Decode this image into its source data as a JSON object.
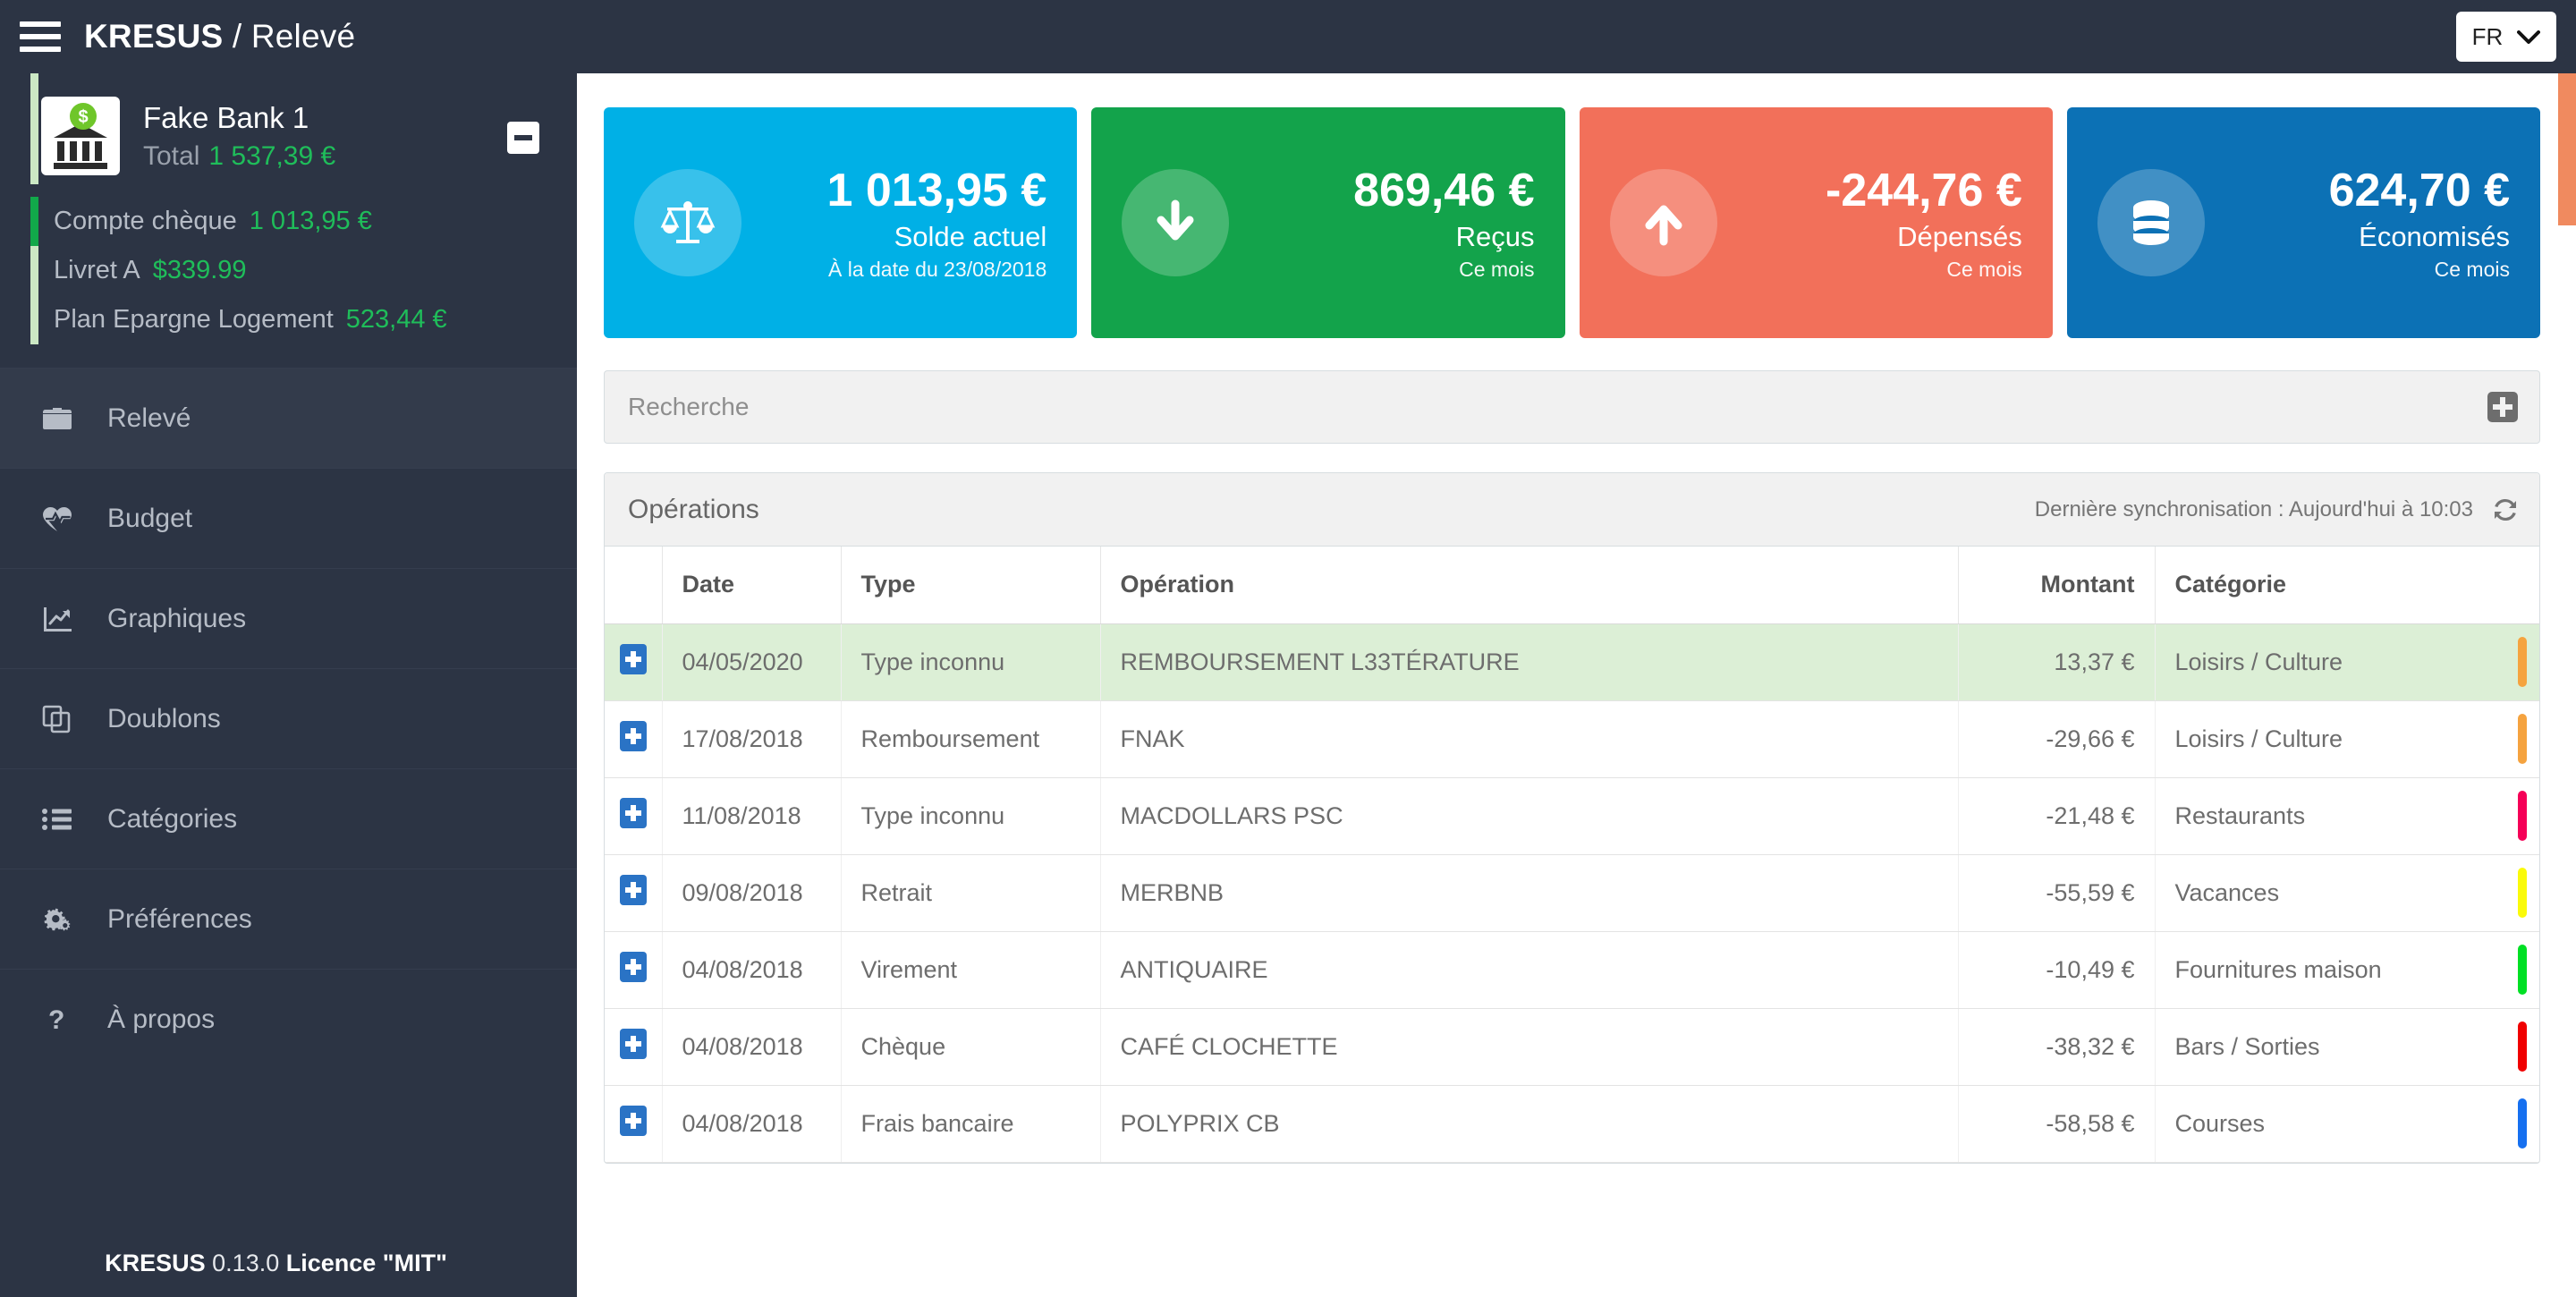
{
  "topbar": {
    "menu_icon": "hamburger-icon",
    "brand": "KRESUS",
    "separator": " / ",
    "page": "Relevé",
    "language": "FR",
    "language_chevron": "chevron-down-icon"
  },
  "sidebar": {
    "bank": {
      "name": "Fake Bank 1",
      "total_label": "Total",
      "total_value": "1 537,39 €",
      "logo_icon": "bank-icon",
      "collapse_icon": "minus-icon"
    },
    "accounts": [
      {
        "label": "Compte chèque",
        "value": "1 013,95 €",
        "active": true,
        "stripe_color": "#11a84a"
      },
      {
        "label": "Livret A",
        "value": "$339.99",
        "active": false,
        "stripe_color": "#cbe8c4"
      },
      {
        "label": "Plan Epargne Logement",
        "value": "523,44 €",
        "active": false,
        "stripe_color": "#cbe8c4"
      }
    ],
    "nav": [
      {
        "label": "Relevé",
        "icon": "briefcase-icon",
        "active": true
      },
      {
        "label": "Budget",
        "icon": "heartbeat-icon",
        "active": false
      },
      {
        "label": "Graphiques",
        "icon": "line-chart-icon",
        "active": false
      },
      {
        "label": "Doublons",
        "icon": "copy-icon",
        "active": false
      },
      {
        "label": "Catégories",
        "icon": "list-icon",
        "active": false
      },
      {
        "label": "Préférences",
        "icon": "gears-icon",
        "active": false
      },
      {
        "label": "À propos",
        "icon": "question-icon",
        "active": false
      }
    ],
    "footer": {
      "brand": "KRESUS",
      "version": "0.13.0",
      "license": "Licence \"MIT\""
    }
  },
  "summary_cards": [
    {
      "amount": "1 013,95 €",
      "label": "Solde actuel",
      "sub": "À la date du 23/08/2018",
      "color": "#00b0e6",
      "icon": "balance-scale-icon"
    },
    {
      "amount": "869,46 €",
      "label": "Reçus",
      "sub": "Ce mois",
      "color": "#13a34b",
      "icon": "arrow-down-icon"
    },
    {
      "amount": "-244,76 €",
      "label": "Dépensés",
      "sub": "Ce mois",
      "color": "#f2705a",
      "icon": "arrow-up-icon"
    },
    {
      "amount": "624,70 €",
      "label": "Économisés",
      "sub": "Ce mois",
      "color": "#0c71b5",
      "icon": "database-icon"
    }
  ],
  "search": {
    "placeholder": "Recherche",
    "expand_icon": "plus-icon"
  },
  "operations_panel": {
    "title": "Opérations",
    "sync_text": "Dernière synchronisation : Aujourd'hui à 10:03",
    "sync_icon": "refresh-icon",
    "columns": [
      "",
      "Date",
      "Type",
      "Opération",
      "Montant",
      "Catégorie"
    ],
    "rows": [
      {
        "expand_icon": "plus-icon",
        "date": "04/05/2020",
        "type": "Type inconnu",
        "operation": "REMBOURSEMENT L33TÉRATURE",
        "amount": "13,37 €",
        "category": "Loisirs / Culture",
        "category_color": "#f5a33f",
        "future": true
      },
      {
        "expand_icon": "plus-icon",
        "date": "17/08/2018",
        "type": "Remboursement",
        "operation": "FNAK",
        "amount": "-29,66 €",
        "category": "Loisirs / Culture",
        "category_color": "#f5a33f",
        "future": false
      },
      {
        "expand_icon": "plus-icon",
        "date": "11/08/2018",
        "type": "Type inconnu",
        "operation": "MACDOLLARS PSC",
        "amount": "-21,48 €",
        "category": "Restaurants",
        "category_color": "#f50057",
        "future": false
      },
      {
        "expand_icon": "plus-icon",
        "date": "09/08/2018",
        "type": "Retrait",
        "operation": "MERBNB",
        "amount": "-55,59 €",
        "category": "Vacances",
        "category_color": "#fafa0a",
        "future": false
      },
      {
        "expand_icon": "plus-icon",
        "date": "04/08/2018",
        "type": "Virement",
        "operation": "ANTIQUAIRE",
        "amount": "-10,49 €",
        "category": "Fournitures maison",
        "category_color": "#00e024",
        "future": false
      },
      {
        "expand_icon": "plus-icon",
        "date": "04/08/2018",
        "type": "Chèque",
        "operation": "CAFÉ CLOCHETTE",
        "amount": "-38,32 €",
        "category": "Bars / Sorties",
        "category_color": "#f00000",
        "future": false
      },
      {
        "expand_icon": "plus-icon",
        "date": "04/08/2018",
        "type": "Frais bancaire",
        "operation": "POLYPRIX CB",
        "amount": "-58,58 €",
        "category": "Courses",
        "category_color": "#1670f0",
        "future": false
      }
    ]
  },
  "scrollbar": {
    "thumb_color": "#f08a5f"
  }
}
